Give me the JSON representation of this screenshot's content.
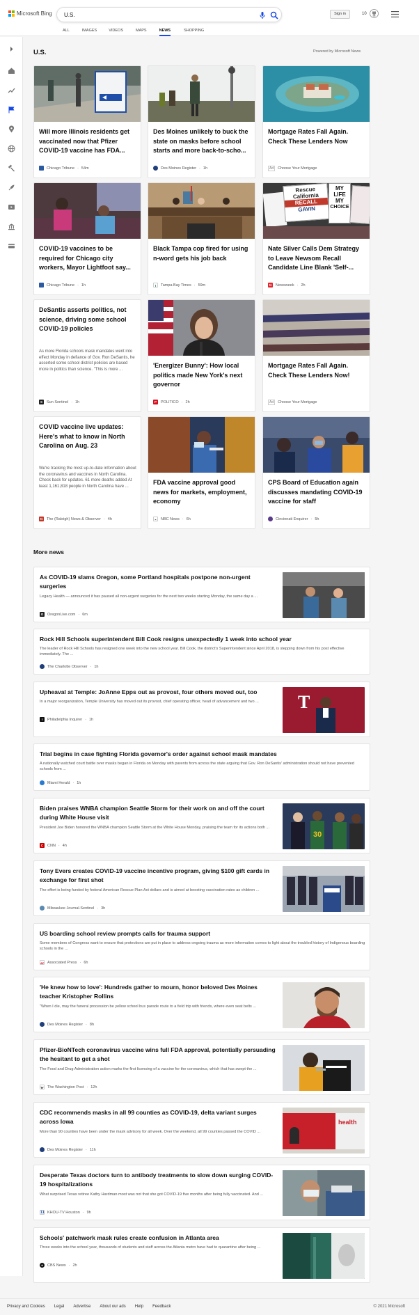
{
  "header": {
    "logo_text": "Microsoft Bing",
    "search_value": "U.S.",
    "tabs": [
      "ALL",
      "IMAGES",
      "VIDEOS",
      "MAPS",
      "NEWS",
      "SHOPPING"
    ],
    "active_tab": "NEWS",
    "signin_label": "Sign in",
    "rewards_count": "10"
  },
  "colors": {
    "accent": "#174ae4",
    "logo": [
      "#f25022",
      "#7fba00",
      "#00a4ef",
      "#ffb900"
    ]
  },
  "section": {
    "title": "U.S.",
    "powered_by": "Powered by Microsoft News"
  },
  "cards": [
    {
      "title": "Will more Illinois residents get vaccinated now that Pfizer COVID-19 vaccine has FDA...",
      "source": "Chicago Tribune",
      "age": "54m"
    },
    {
      "title": "Des Moines unlikely to buck the state on masks before school starts and more back-to-scho...",
      "source": "Des Moines Register",
      "age": "1h"
    },
    {
      "title": "Mortgage Rates Fall Again. Check These Lenders Now",
      "source": "Choose Your Mortgage",
      "age": "",
      "badge": "Ad"
    },
    {
      "title": "COVID-19 vaccines to be required for Chicago city workers, Mayor Lightfoot say...",
      "source": "Chicago Tribune",
      "age": "1h"
    },
    {
      "title": "Black Tampa cop fired for using n-word gets his job back",
      "source": "Tampa Bay Times",
      "age": "59m"
    },
    {
      "title": "Nate Silver Calls Dem Strategy to Leave Newsom Recall Candidate Line Blank 'Self-...",
      "source": "Newsweek",
      "age": "2h",
      "sign_text": [
        "Rescue",
        "California",
        "RECALL",
        "GAVIN",
        "MY",
        "LIFE",
        "MY",
        "CHOICE"
      ]
    },
    {
      "title": "DeSantis asserts politics, not science, driving some school COVID-19 policies",
      "snippet": "As more Florida schools mask mandates went into effect Monday in defiance of Gov. Ron DeSantis, he asserted some school district policies are based more in politics than science. \"This is more ...",
      "source": "Sun Sentinel",
      "age": "1h"
    },
    {
      "title": "'Energizer Bunny': How local politics made New York's next governor",
      "source": "POLITICO",
      "age": "2h"
    },
    {
      "title": "Mortgage Rates Fall Again. Check These Lenders Now!",
      "source": "Choose Your Mortgage",
      "age": "",
      "badge": "Ad"
    },
    {
      "title": "COVID vaccine live updates: Here's what to know in North Carolina on Aug. 23",
      "snippet": "We're tracking the most up-to-date information about the coronavirus and vaccines in North Carolina. Check back for updates. 61 more deaths added At least 1,161,818 people in North Carolina have ...",
      "source": "The (Raleigh) News & Observer",
      "age": "4h"
    },
    {
      "title": "FDA vaccine approval good news for markets, employment, economy",
      "source": "NBC News",
      "age": "6h"
    },
    {
      "title": "CPS Board of Education again discusses mandating COVID-19 vaccine for staff",
      "source": "Cincinnati Enquirer",
      "age": "5h"
    }
  ],
  "more_news": {
    "title": "More news",
    "items": [
      {
        "title": "As COVID-19 slams Oregon, some Portland hospitals postpone non-urgent surgeries",
        "snippet": "Legacy Health — announced it has paused all non-urgent surgeries for the next two weeks starting Monday, the same day a ...",
        "source": "OregonLive.com",
        "age": "6m"
      },
      {
        "title": "Rock Hill Schools superintendent Bill Cook resigns unexpectedly 1 week into school year",
        "snippet": "The leader of Rock Hill Schools has resigned one week into the new school year. Bill Cook, the district's Superintendent since April 2018, is stepping down from his post effective immediately. The ...",
        "source": "The Charlotte Observer",
        "age": "1h"
      },
      {
        "title": "Upheaval at Temple: JoAnne Epps out as provost, four others moved out, too",
        "snippet": "In a major reorganization, Temple University has moved out its provost, chief operating officer, head of advancement and two ...",
        "source": "Philadelphia Inquirer",
        "age": "1h"
      },
      {
        "title": "Trial begins in case fighting Florida governor's order against school mask mandates",
        "snippet": "A nationally watched court battle over masks began in Florida on Monday with parents from across the state arguing that Gov. Ron DeSantis' administration should not have prevented schools from ...",
        "source": "Miami Herald",
        "age": "1h"
      },
      {
        "title": "Biden praises WNBA champion Seattle Storm for their work on and off the court during White House visit",
        "snippet": "President Joe Biden honored the WNBA champion Seattle Storm at the White House Monday, praising the team for its actions both ...",
        "source": "CNN",
        "age": "4h"
      },
      {
        "title": "Tony Evers creates COVID-19 vaccine incentive program, giving $100 gift cards in exchange for first shot",
        "snippet": "The effort is being funded by federal American Rescue Plan Act dollars and is aimed at boosting vaccination rates as children ...",
        "source": "Milwaukee Journal-Sentinel",
        "age": "3h"
      },
      {
        "title": "US boarding school review prompts calls for trauma support",
        "snippet": "Some members of Congress want to ensure that protections are put in place to address ongoing trauma as more information comes to light about the troubled history of Indigenous boarding schools in the ...",
        "source": "Associated Press",
        "age": "6h"
      },
      {
        "title": "'He knew how to love': Hundreds gather to mourn, honor beloved Des Moines teacher Kristopher Rollins",
        "snippet": "\"When I die, may the funeral procession be yellow school bus parade route to a field trip with friends, where even seat belts ...",
        "source": "Des Moines Register",
        "age": "8h"
      },
      {
        "title": "Pfizer-BioNTech coronavirus vaccine wins full FDA approval, potentially persuading the hesitant to get a shot",
        "snippet": "The Food and Drug Administration action marks the first licensing of a vaccine for the coronavirus, which that has swept the ...",
        "source": "The Washington Post",
        "age": "12h"
      },
      {
        "title": "CDC recommends masks in all 99 counties as COVID-19, delta variant surges across Iowa",
        "snippet": "More than 90 counties have been under the mask advisory for all week. Over the weekend, all 99 counties passed the COVID ...",
        "source": "Des Moines Register",
        "age": "11h",
        "thumb_text": "health"
      },
      {
        "title": "Desperate Texas doctors turn to antibody treatments to slow down surging COVID-19 hospitalizations",
        "snippet": "What surprised Texas retiree Kathy Hardman most was not that she got COVID-19 five months after being fully vaccinated. And ...",
        "source": "KHOU-TV Houston",
        "age": "9h"
      },
      {
        "title": "Schools' patchwork mask rules create confusion in Atlanta area",
        "snippet": "Three weeks into the school year, thousands of students and staff across the Atlanta metro have had to quarantine after being ...",
        "source": "CBS News",
        "age": "2h"
      }
    ]
  },
  "footer": {
    "links": [
      "Privacy and Cookies",
      "Legal",
      "Advertise",
      "About our ads",
      "Help",
      "Feedback"
    ],
    "copyright": "© 2021 Microsoft"
  }
}
